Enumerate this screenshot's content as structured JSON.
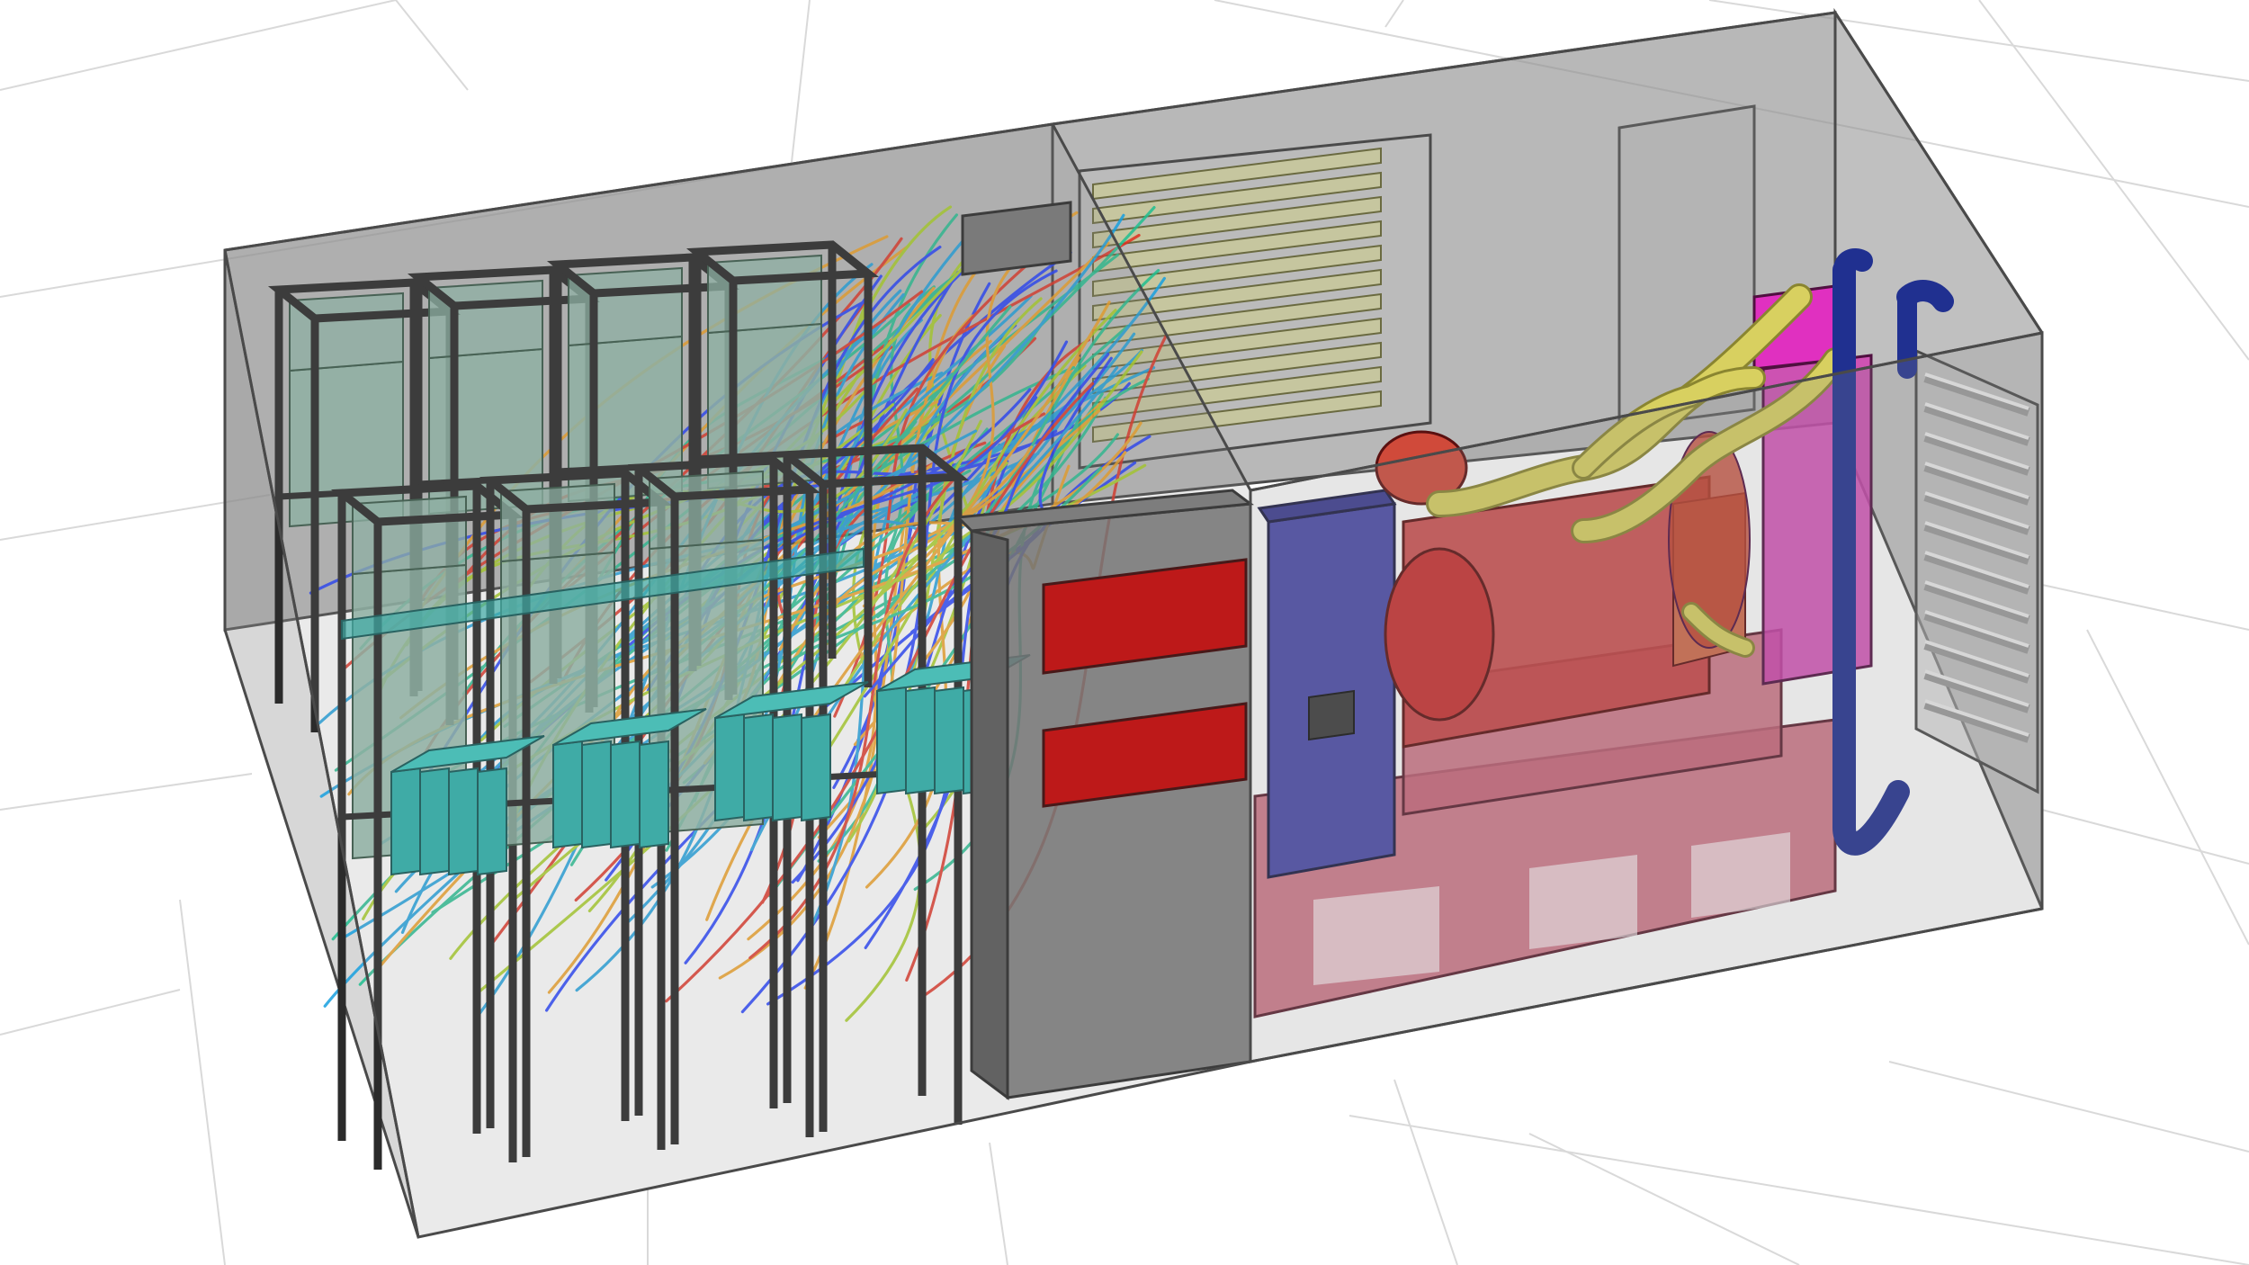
{
  "colors": {
    "background": "#ffffff",
    "floor_grid": "#d9d9d9",
    "enclosure_glass": "#8c8c8c",
    "enclosure_edge": "#4a4a4a",
    "rack_frame": "#2b2b2b",
    "server_block": "#8fb8a8",
    "battery_pack": "#2fb3ad",
    "cooling_unit": "#6e6e6e",
    "alarm_panel": "#c80000",
    "louver": "#c8c89a",
    "generator_base": "#c86478",
    "engine_block": "#c84040",
    "exhaust_pipe": "#d8d060",
    "radiator_housing": "#d040b0",
    "control_cabinet": "#4a4aa8",
    "exhaust_duct": "#203090",
    "streamline_palette": [
      "#1e3cff",
      "#18a0e0",
      "#20c090",
      "#a8d020",
      "#f0a020",
      "#e03020"
    ]
  },
  "icons": {
    "server_racks": "rack-icon",
    "airflow": "streamline-icon",
    "generator": "generator-icon",
    "radiator": "radiator-icon"
  },
  "counts": {
    "rear_racks": 4,
    "front_racks": 4,
    "battery_groups": 4,
    "wall_louvers": 11,
    "radiator_fins": 12,
    "alarm_panels": 2
  }
}
